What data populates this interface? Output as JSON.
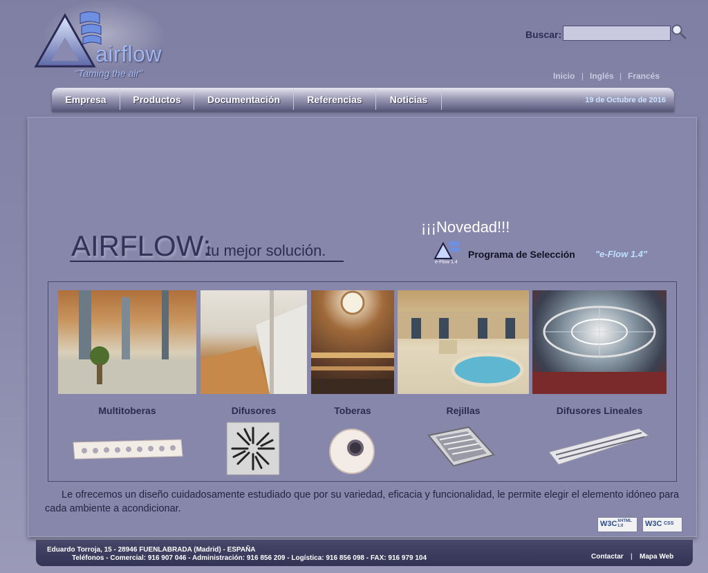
{
  "header": {
    "logo_text": "airflow",
    "logo_tagline": "\"Taming the air\"",
    "search_label": "Buscar:",
    "search_value": "",
    "lang_links": [
      "Inicio",
      "Inglés",
      "Francés"
    ],
    "separator": "|"
  },
  "nav": {
    "items": [
      "Empresa",
      "Productos",
      "Documentación",
      "Referencias",
      "Noticias"
    ],
    "date": "19 de Octubre de 2016"
  },
  "hero": {
    "brand": "AIRFLOW:",
    "slogan": "tu mejor solución.",
    "news_title": "¡¡¡Novedad!!!",
    "program_label": "Programa de Selección",
    "program_version": "\"e-Flow 1.4\"",
    "icon_caption": "e-Flow 1.4"
  },
  "products": [
    {
      "title": "Multitoberas"
    },
    {
      "title": "Difusores"
    },
    {
      "title": "Toberas"
    },
    {
      "title": "Rejillas"
    },
    {
      "title": "Difusores Lineales"
    }
  ],
  "description": "Le ofrecemos un diseño cuidadosamente estudiado que por su variedad, eficacia y funcionalidad, le permite elegir el elemento idóneo para cada ambiente a acondicionar.",
  "badges": {
    "xhtml": "XHTML 1.0",
    "css": "CSS",
    "w3c": "W3C"
  },
  "footer": {
    "address": "Eduardo Torroja, 15 - 28946 FUENLABRADA (Madrid) - ESPAÑA",
    "phones": "Teléfonos - Comercial: 916 907 046 - Administración: 916 856 209 - Logística: 916 856 098 - FAX: 916 979 104",
    "links": [
      "Contactar",
      "Mapa Web"
    ],
    "separator": "|"
  },
  "colors": {
    "page_bg": "#8787ab",
    "accent_link": "#bde0ff",
    "footer_bg": "#3a3a5e"
  }
}
